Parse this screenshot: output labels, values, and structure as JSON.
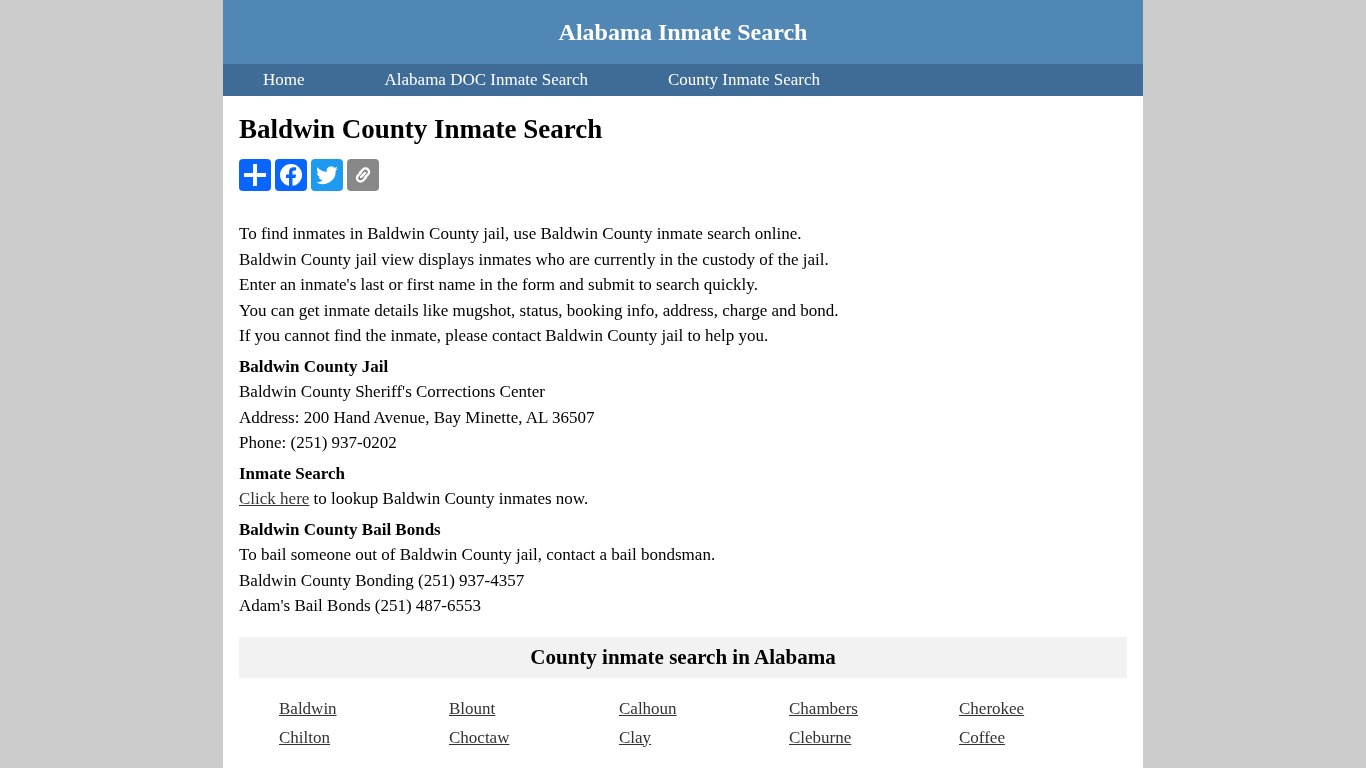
{
  "site_title": "Alabama Inmate Search",
  "nav": [
    {
      "label": "Home"
    },
    {
      "label": "Alabama DOC Inmate Search"
    },
    {
      "label": "County Inmate Search"
    }
  ],
  "page_title": "Baldwin County Inmate Search",
  "share_buttons": [
    {
      "kind": "share"
    },
    {
      "kind": "facebook"
    },
    {
      "kind": "twitter"
    },
    {
      "kind": "copy-link"
    }
  ],
  "intro": [
    "To find inmates in Baldwin County jail, use Baldwin County inmate search online.",
    "Baldwin County jail view displays inmates who are currently in the custody of the jail.",
    "Enter an inmate's last or first name in the form and submit to search quickly.",
    "You can get inmate details like mugshot, status, booking info, address, charge and bond.",
    "If you cannot find the inmate, please contact Baldwin County jail to help you."
  ],
  "sections": [
    {
      "heading": "Baldwin County Jail",
      "lines": [
        {
          "text": "Baldwin County Sheriff's Corrections Center"
        },
        {
          "text": "Address: 200 Hand Avenue, Bay Minette, AL 36507"
        },
        {
          "text": "Phone: (251) 937-0202"
        }
      ]
    },
    {
      "heading": "Inmate Search",
      "lines": [
        {
          "link": "Click here",
          "text": " to lookup Baldwin County inmates now."
        }
      ]
    },
    {
      "heading": "Baldwin County Bail Bonds",
      "lines": [
        {
          "text": "To bail someone out of Baldwin County jail, contact a bail bondsman."
        },
        {
          "text": "Baldwin County Bonding (251) 937-4357"
        },
        {
          "text": "Adam's Bail Bonds (251) 487-6553"
        }
      ]
    }
  ],
  "county_box": {
    "title": "County inmate search in Alabama",
    "counties": [
      "Baldwin",
      "Blount",
      "Calhoun",
      "Chambers",
      "Cherokee",
      "Chilton",
      "Choctaw",
      "Clay",
      "Cleburne",
      "Coffee"
    ]
  }
}
